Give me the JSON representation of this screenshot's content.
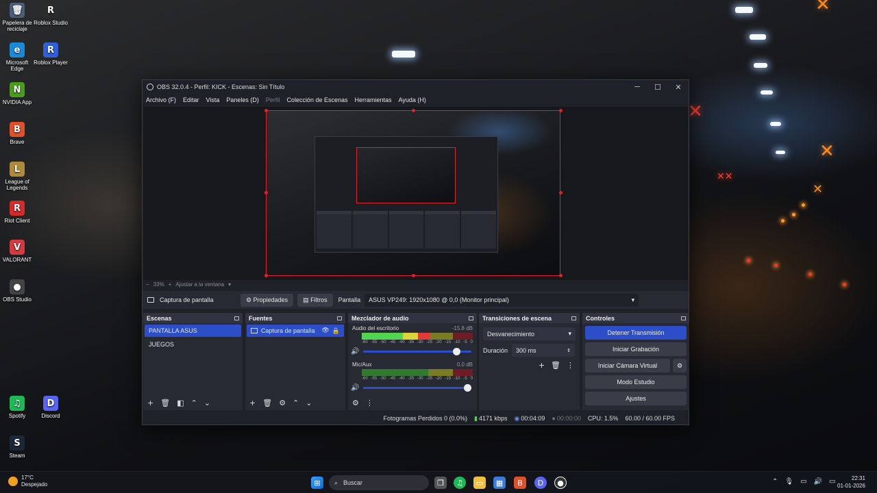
{
  "desktop": {
    "icons": [
      {
        "label": "Papelera de reciclaje",
        "glyph": "🗑",
        "color": "#4a5d7a"
      },
      {
        "label": "Roblox Studio",
        "glyph": "R",
        "color": "#2b2b2b"
      },
      {
        "label": "Microsoft Edge",
        "glyph": "e",
        "color": "#1a8ad8"
      },
      {
        "label": "Roblox Player",
        "glyph": "R",
        "color": "#2f5fd9"
      },
      {
        "label": "NVIDIA App",
        "glyph": "N",
        "color": "#4a9d1c"
      },
      {
        "label": "Brave",
        "glyph": "B",
        "color": "#e0502a"
      },
      {
        "label": "League of Legends",
        "glyph": "L",
        "color": "#b08a3a"
      },
      {
        "label": "Riot Client",
        "glyph": "R",
        "color": "#d42a2a"
      },
      {
        "label": "VALORANT",
        "glyph": "V",
        "color": "#d43a40"
      },
      {
        "label": "OBS Studio",
        "glyph": "●",
        "color": "#444"
      },
      {
        "label": "Spotify",
        "glyph": "♫",
        "color": "#1db954"
      },
      {
        "label": "Discord",
        "glyph": "D",
        "color": "#5865f2"
      },
      {
        "label": "Steam",
        "glyph": "S",
        "color": "#1b2838"
      }
    ]
  },
  "obs": {
    "title": "OBS 32.0.4 - Perfil: KICK - Escenas: Sin Título",
    "menu": [
      "Archivo (F)",
      "Editar",
      "Vista",
      "Paneles (D)",
      "Perfil",
      "Colección de Escenas",
      "Herramientas",
      "Ayuda (H)"
    ],
    "zoom": "33%",
    "fit_label": "Ajustar a la ventana",
    "source_bar": {
      "source_name": "Captura de pantalla",
      "properties_label": "Propiedades",
      "filters_label": "Filtros",
      "display_label": "Pantalla",
      "display_value": "ASUS VP249: 1920x1080 @ 0,0 (Monitor principal)"
    },
    "scenes": {
      "title": "Escenas",
      "items": [
        "PANTALLA ASUS",
        "JUEGOS"
      ]
    },
    "sources": {
      "title": "Fuentes",
      "items": [
        "Captura de pantalla"
      ]
    },
    "mixer": {
      "title": "Mezclador de audio",
      "channels": [
        {
          "name": "Audio del escritorio",
          "db": "-15.8 dB",
          "level": 0.62,
          "volume": 0.9
        },
        {
          "name": "Mic/Aux",
          "db": "0.0 dB",
          "level": 0.0,
          "volume": 1.0
        }
      ],
      "scale": [
        "-60",
        "-55",
        "-50",
        "-45",
        "-40",
        "-35",
        "-30",
        "-25",
        "-20",
        "-15",
        "-10",
        "-5",
        "0"
      ]
    },
    "transitions": {
      "title": "Transiciones de escena",
      "selected": "Desvanecimiento",
      "duration_label": "Duración",
      "duration_value": "300 ms"
    },
    "controls": {
      "title": "Controles",
      "stop_stream": "Detener Transmisión",
      "start_recording": "Iniciar Grabación",
      "start_virtual_cam": "Iniciar Cámara Virtual",
      "studio_mode": "Modo Estudio",
      "settings": "Ajustes"
    },
    "status": {
      "dropped_frames": "Fotogramas Perdidos 0 (0.0%)",
      "bitrate": "4171 kbps",
      "stream_time": "00:04:09",
      "rec_time": "00:00:00",
      "cpu": "CPU: 1.5%",
      "fps": "60.00 / 60.00 FPS"
    }
  },
  "taskbar": {
    "weather_temp": "17°C",
    "weather_desc": "Despejado",
    "search_placeholder": "Buscar",
    "time": "22:31",
    "date": "01-01-2026"
  }
}
